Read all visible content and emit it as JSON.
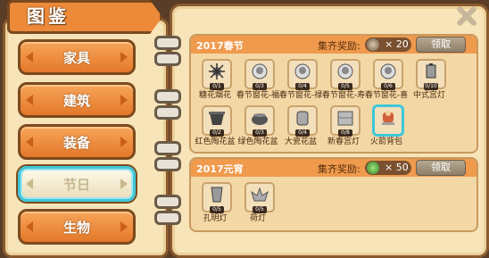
{
  "header": {
    "title": "图鉴"
  },
  "categories": [
    {
      "label": "家具",
      "active": false
    },
    {
      "label": "建筑",
      "active": false
    },
    {
      "label": "装备",
      "active": false
    },
    {
      "label": "节日",
      "active": true
    },
    {
      "label": "生物",
      "active": false
    }
  ],
  "sections": [
    {
      "title": "2017春节",
      "reward_label": "集齐奖励:",
      "reward_icon": "lantern-icon",
      "reward_count": "× 20",
      "claim_label": "领取",
      "items": [
        {
          "name": "糖花烟花",
          "count": "0/1",
          "icon": "firework-icon"
        },
        {
          "name": "春节窗花-福",
          "count": "0/3",
          "icon": "paper-cut-fu-icon"
        },
        {
          "name": "春节窗花-禄",
          "count": "0/4",
          "icon": "paper-cut-lu-icon"
        },
        {
          "name": "春节窗花-寿",
          "count": "0/5",
          "icon": "paper-cut-shou-icon"
        },
        {
          "name": "春节窗花-喜",
          "count": "0/6",
          "icon": "paper-cut-xi-icon"
        },
        {
          "name": "中式宫灯",
          "count": "0/10",
          "icon": "palace-lantern-icon"
        },
        {
          "name": "红色陶花盆",
          "count": "0/2",
          "icon": "red-pot-icon"
        },
        {
          "name": "绿色陶花盆",
          "count": "0/3",
          "icon": "green-pot-icon"
        },
        {
          "name": "大瓷花盆",
          "count": "0/4",
          "icon": "porcelain-pot-icon"
        },
        {
          "name": "新春宫灯",
          "count": "0/8",
          "icon": "new-year-lantern-icon"
        },
        {
          "name": "火箭背包",
          "count": "",
          "icon": "rocket-backpack-icon",
          "selected": true
        }
      ]
    },
    {
      "title": "2017元宵",
      "reward_label": "集齐奖励:",
      "reward_icon": "green-gem-icon",
      "reward_count": "× 50",
      "claim_label": "领取",
      "items": [
        {
          "name": "孔明灯",
          "count": "0/5",
          "icon": "sky-lantern-icon"
        },
        {
          "name": "荷灯",
          "count": "0/5",
          "icon": "lotus-lantern-icon"
        }
      ]
    }
  ],
  "colors": {
    "accent": "#ec8a3a",
    "selected": "#3ec6d9",
    "border": "#7c4a1e"
  }
}
